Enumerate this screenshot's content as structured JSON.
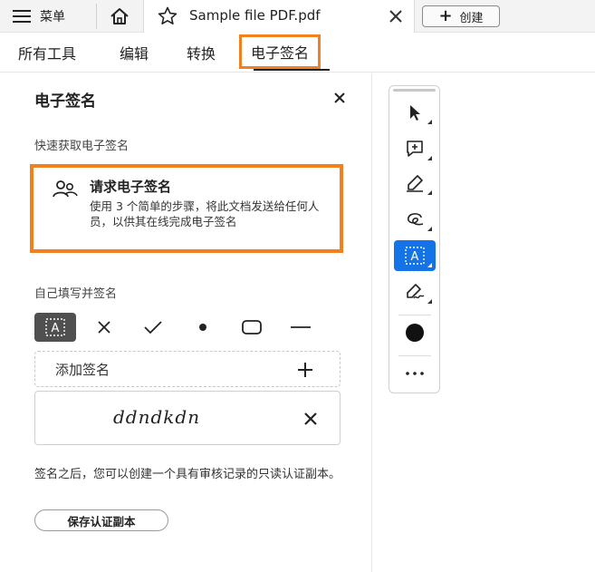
{
  "topbar": {
    "menu_label": "菜单",
    "document_tab_title": "Sample file PDF.pdf",
    "create_label": "创建"
  },
  "tool_tabs": [
    {
      "label": "所有工具"
    },
    {
      "label": "编辑"
    },
    {
      "label": "转换"
    },
    {
      "label": "电子签名",
      "active": true
    }
  ],
  "panel": {
    "title": "电子签名",
    "quick_section_label": "快速获取电子签名",
    "request": {
      "title": "请求电子签名",
      "description": "使用 3 个简单的步骤，将此文档发送给任何人员，以供其在线完成电子签名"
    },
    "self_sign_label": "自己填写并签名",
    "field_tools": [
      "text-field-icon",
      "cross-mark-icon",
      "check-mark-icon",
      "dot-icon",
      "rounded-rect-icon",
      "line-icon"
    ],
    "add_signature_label": "添加签名",
    "signature_text": "ddndkdn",
    "after_note": "签名之后，您可以创建一个具有审核记录的只读认证副本。",
    "save_certified_copy_label": "保存认证副本"
  },
  "right_toolbar": {
    "tools": [
      "select-cursor-icon",
      "add-comment-icon",
      "highlight-pen-icon",
      "freehand-draw-icon",
      "text-field-icon",
      "sign-icon",
      "color-dot-icon",
      "more-icon"
    ],
    "selected_tool": "text-field-icon"
  },
  "colors": {
    "accent_orange": "#f08020",
    "selected_blue": "#1473e6",
    "selected_gray": "#505050"
  }
}
